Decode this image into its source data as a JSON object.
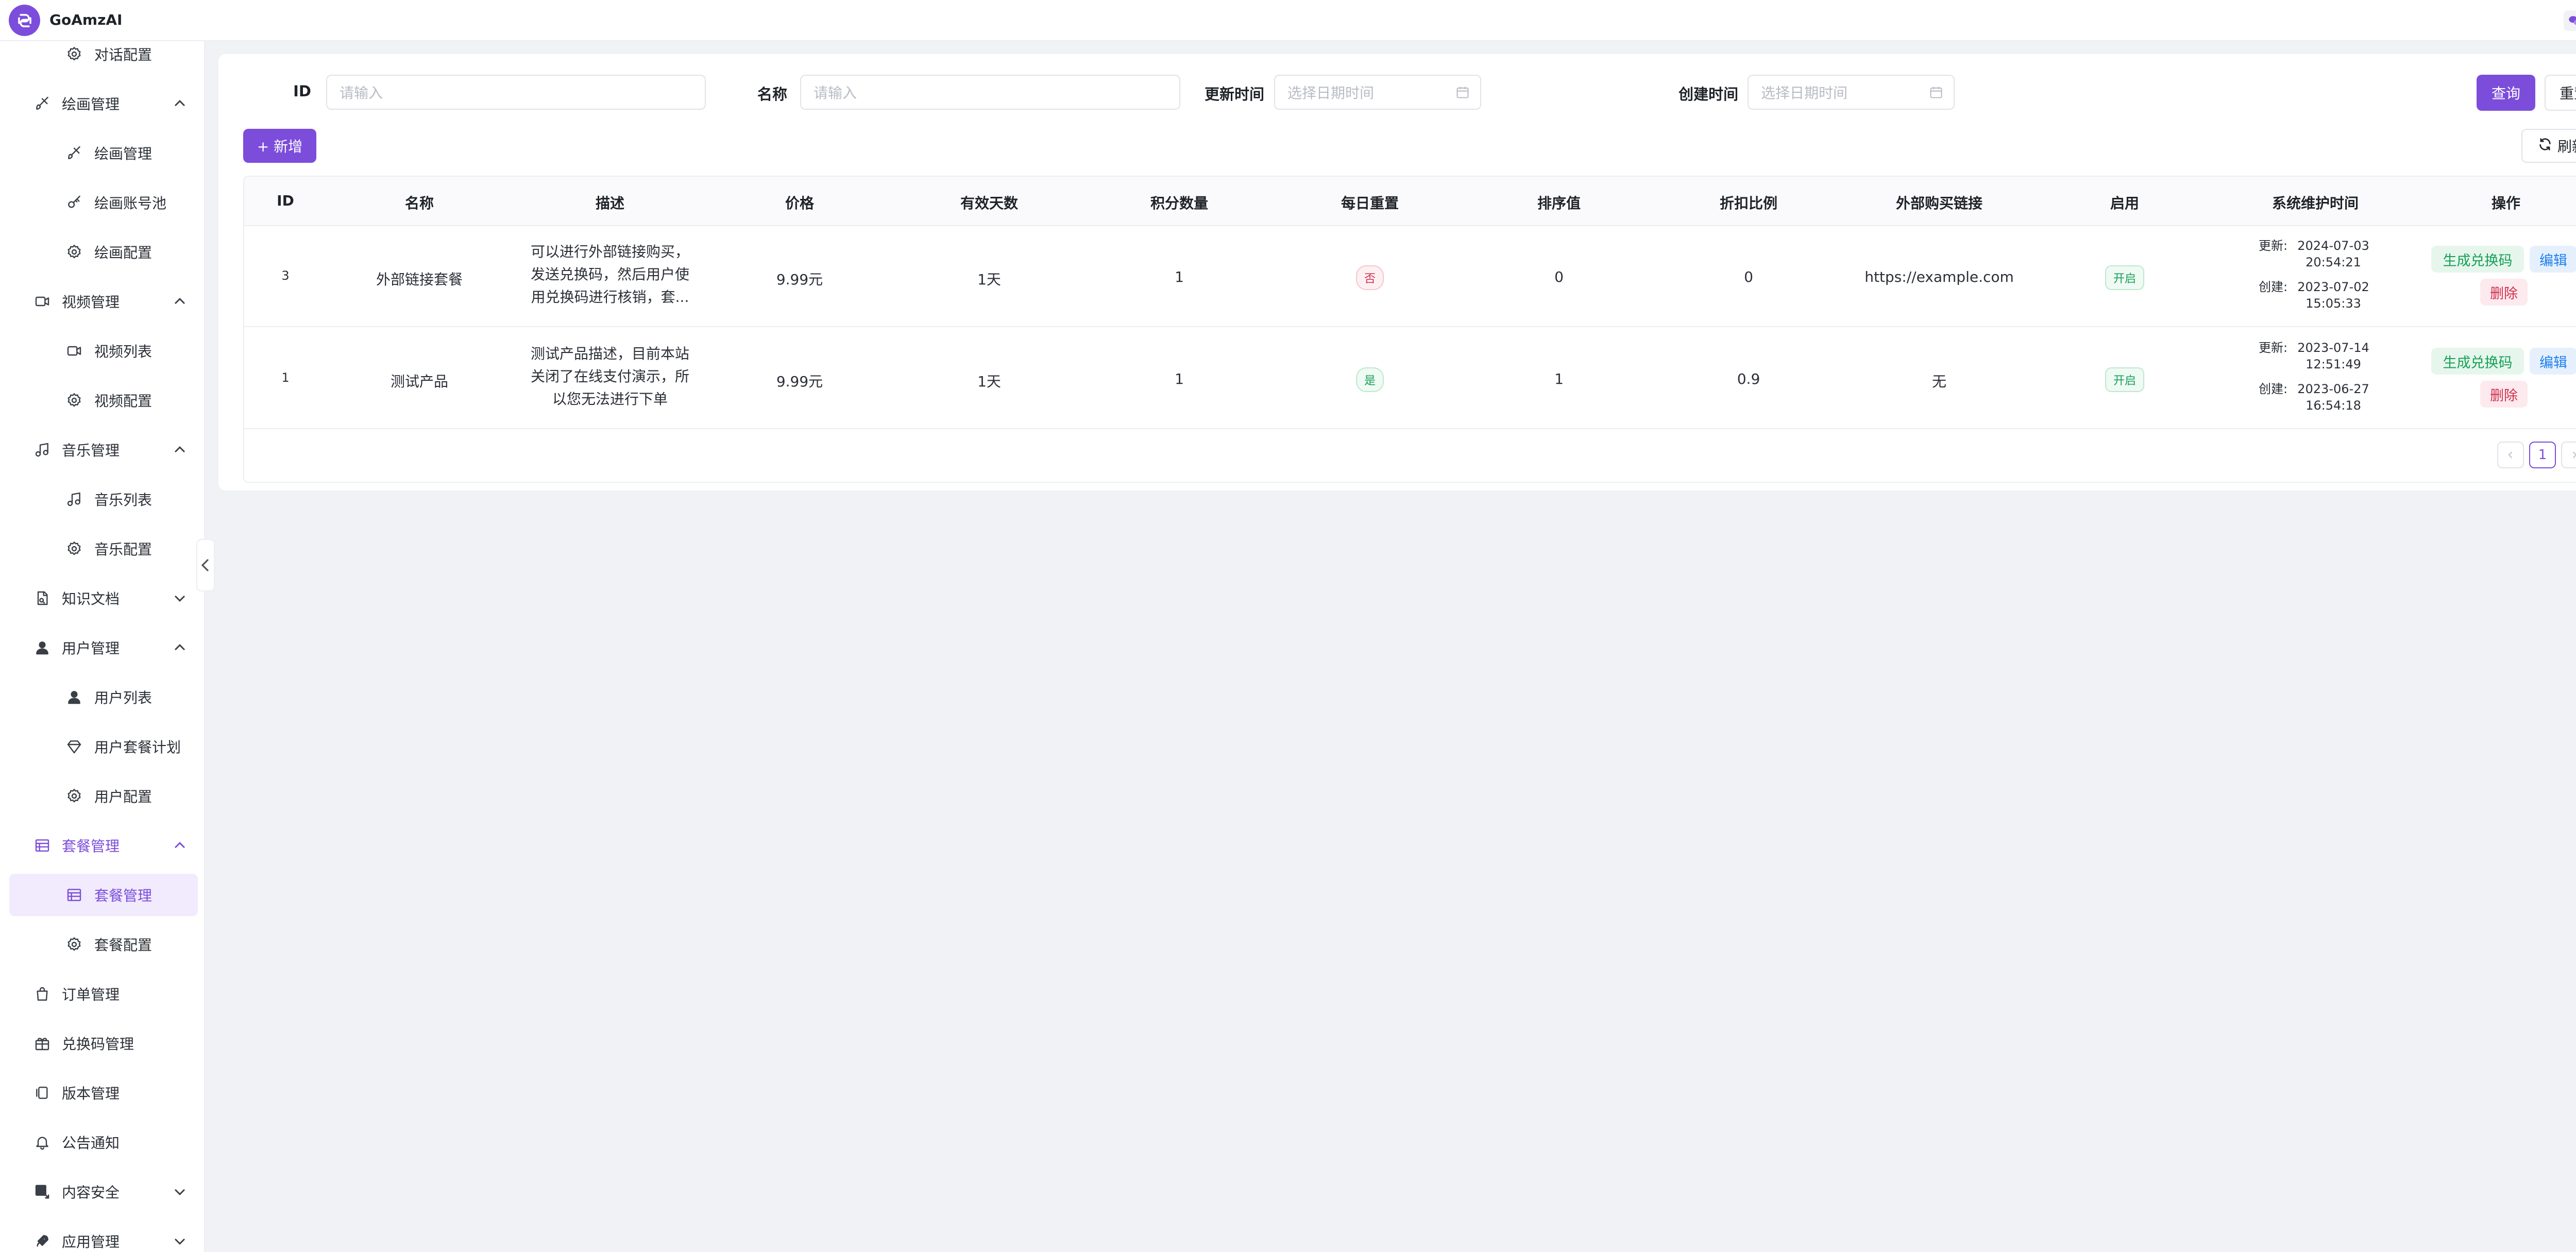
{
  "app": {
    "title": "GoAmzAI"
  },
  "sidebar": {
    "items": [
      {
        "label": "对话配置",
        "icon": "gear-icon",
        "level": "sub"
      },
      {
        "label": "绘画管理",
        "icon": "brush-icon",
        "level": "top",
        "chevron": "up"
      },
      {
        "label": "绘画管理",
        "icon": "brush-icon",
        "level": "sub"
      },
      {
        "label": "绘画账号池",
        "icon": "key-icon",
        "level": "sub"
      },
      {
        "label": "绘画配置",
        "icon": "gear-icon",
        "level": "sub"
      },
      {
        "label": "视频管理",
        "icon": "video-icon",
        "level": "top",
        "chevron": "up"
      },
      {
        "label": "视频列表",
        "icon": "video-icon",
        "level": "sub"
      },
      {
        "label": "视频配置",
        "icon": "gear-icon",
        "level": "sub"
      },
      {
        "label": "音乐管理",
        "icon": "music-icon",
        "level": "top",
        "chevron": "up"
      },
      {
        "label": "音乐列表",
        "icon": "music-icon",
        "level": "sub"
      },
      {
        "label": "音乐配置",
        "icon": "gear-icon",
        "level": "sub"
      },
      {
        "label": "知识文档",
        "icon": "document-icon",
        "level": "top",
        "chevron": "down"
      },
      {
        "label": "用户管理",
        "icon": "user-icon",
        "level": "top",
        "chevron": "up"
      },
      {
        "label": "用户列表",
        "icon": "user-icon",
        "level": "sub"
      },
      {
        "label": "用户套餐计划",
        "icon": "diamond-icon",
        "level": "sub"
      },
      {
        "label": "用户配置",
        "icon": "gear-icon",
        "level": "sub"
      },
      {
        "label": "套餐管理",
        "icon": "store-icon",
        "level": "top",
        "chevron": "up",
        "state": "group-active"
      },
      {
        "label": "套餐管理",
        "icon": "store-icon",
        "level": "sub",
        "state": "active"
      },
      {
        "label": "套餐配置",
        "icon": "gear-icon",
        "level": "sub"
      },
      {
        "label": "订单管理",
        "icon": "bag-icon",
        "level": "top"
      },
      {
        "label": "兑换码管理",
        "icon": "gift-icon",
        "level": "top"
      },
      {
        "label": "版本管理",
        "icon": "version-icon",
        "level": "top"
      },
      {
        "label": "公告通知",
        "icon": "bell-icon",
        "level": "top"
      },
      {
        "label": "内容安全",
        "icon": "shield-icon",
        "level": "top",
        "chevron": "down"
      },
      {
        "label": "应用管理",
        "icon": "rocket-icon",
        "level": "top",
        "chevron": "down"
      }
    ]
  },
  "filters": {
    "id_label": "ID",
    "id_placeholder": "请输入",
    "name_label": "名称",
    "name_placeholder": "请输入",
    "updated_label": "更新时间",
    "updated_placeholder": "选择日期时间",
    "created_label": "创建时间",
    "created_placeholder": "选择日期时间",
    "query_button": "查询",
    "reset_button": "重置"
  },
  "toolbar": {
    "add_button": "+ 新增",
    "refresh_button": "刷新"
  },
  "table": {
    "columns": [
      "ID",
      "名称",
      "描述",
      "价格",
      "有效天数",
      "积分数量",
      "每日重置",
      "排序值",
      "折扣比例",
      "外部购买链接",
      "启用",
      "系统维护时间",
      "操作"
    ],
    "rows": [
      {
        "id": "3",
        "name": "外部链接套餐",
        "desc": "可以进行外部链接购买，发送兑换码，然后用户使用兑换码进行核销，套...",
        "price": "9.99元",
        "days": "1天",
        "points": "1",
        "daily_reset": "否",
        "sort": "0",
        "discount": "0",
        "link": "https://example.com",
        "enabled": "开启",
        "updated_label": "更新:",
        "updated_date": "2024-07-03",
        "updated_time": "20:54:21",
        "created_label": "创建:",
        "created_date": "2023-07-02",
        "created_time": "15:05:33",
        "op_generate": "生成兑换码",
        "op_edit": "编辑",
        "op_delete": "删除"
      },
      {
        "id": "1",
        "name": "测试产品",
        "desc": "测试产品描述，目前本站关闭了在线支付演示，所以您无法进行下单",
        "price": "9.99元",
        "days": "1天",
        "points": "1",
        "daily_reset": "是",
        "sort": "1",
        "discount": "0.9",
        "link": "无",
        "enabled": "开启",
        "updated_label": "更新:",
        "updated_date": "2023-07-14",
        "updated_time": "12:51:49",
        "created_label": "创建:",
        "created_date": "2023-06-27",
        "created_time": "16:54:18",
        "op_generate": "生成兑换码",
        "op_edit": "编辑",
        "op_delete": "删除"
      }
    ]
  },
  "pagination": {
    "current": "1"
  },
  "colors": {
    "accent": "#7c4ddb",
    "success": "#18a058",
    "danger": "#d03050",
    "info": "#2080f0"
  }
}
